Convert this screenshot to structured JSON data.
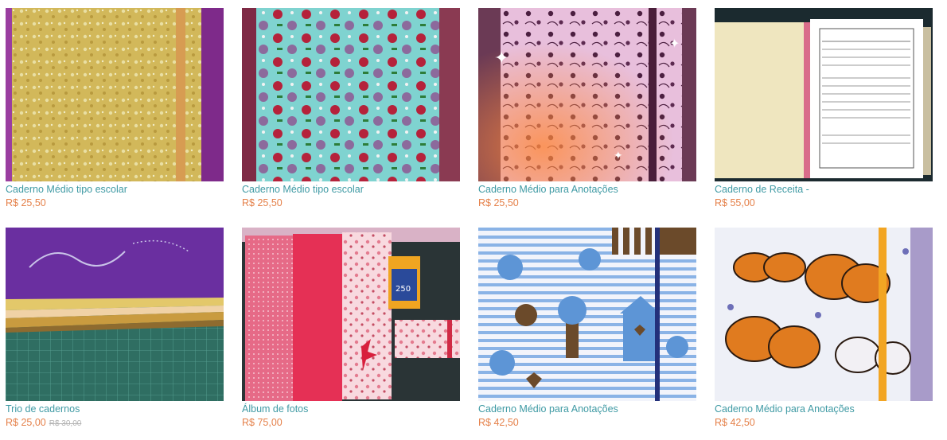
{
  "products": [
    {
      "title": "Caderno Médio tipo escolar",
      "price": "R$ 25,50",
      "image": "yellow-floral-notebook-photo"
    },
    {
      "title": "Caderno Médio tipo escolar",
      "price": "R$ 25,50",
      "image": "apple-print-notebook-photo"
    },
    {
      "title": "Caderno Médio para Anotações",
      "price": "R$ 25,50",
      "image": "pink-floral-notebook-photo"
    },
    {
      "title": "Caderno de Receita -",
      "price": "R$ 55,00",
      "image": "recipe-notebook-open-photo"
    },
    {
      "title": "Trio de cadernos",
      "price": "R$ 25,00",
      "old_price": "R$ 30,00",
      "image": "purple-notebook-trio-photo"
    },
    {
      "title": "Álbum de fotos",
      "price": "R$ 75,00",
      "image": "pink-photo-album-photo"
    },
    {
      "title": "Caderno Médio para Anotações",
      "price": "R$ 42,50",
      "image": "blue-birds-notebook-photo"
    },
    {
      "title": "Caderno Médio para Anotações",
      "price": "R$ 42,50",
      "image": "butterfly-notebook-photo"
    }
  ],
  "colors": {
    "title_link": "#3f9aa4",
    "price": "#e5814a",
    "old_price": "#b3b3b3"
  }
}
